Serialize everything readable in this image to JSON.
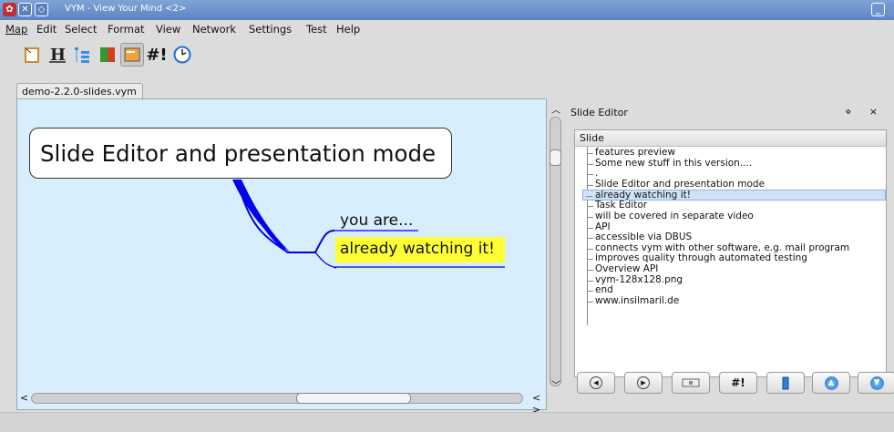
{
  "window": {
    "title": "VYM - View Your Mind <2>"
  },
  "menu": [
    "Map",
    "Edit",
    "Select",
    "Format",
    "View",
    "Network",
    "Settings",
    "Test",
    "Help"
  ],
  "toolbar": {
    "script_label": "#!"
  },
  "tab": {
    "label": "demo-2.2.0-slides.vym"
  },
  "map": {
    "main_node": "Slide Editor and presentation mode",
    "child1": "you are...",
    "child2": "already watching it!"
  },
  "panel": {
    "title": "Slide Editor",
    "header": "Slide",
    "items": [
      "features preview",
      "Some new stuff in this version....",
      ".",
      "Slide Editor and presentation mode",
      "already watching it!",
      "Task Editor",
      "will be covered in separate video",
      "API",
      "accessible via DBUS",
      "connects vym with other software, e.g. mail program",
      "improves quality through automated testing",
      "Overview API",
      "vym-128x128.png",
      "end",
      "www.insilmaril.de"
    ],
    "selected_index": 4,
    "script_button": "#!"
  },
  "colors": {
    "canvas": "#d8eefc",
    "highlight": "#ffff33",
    "branch": "#0000ee"
  }
}
